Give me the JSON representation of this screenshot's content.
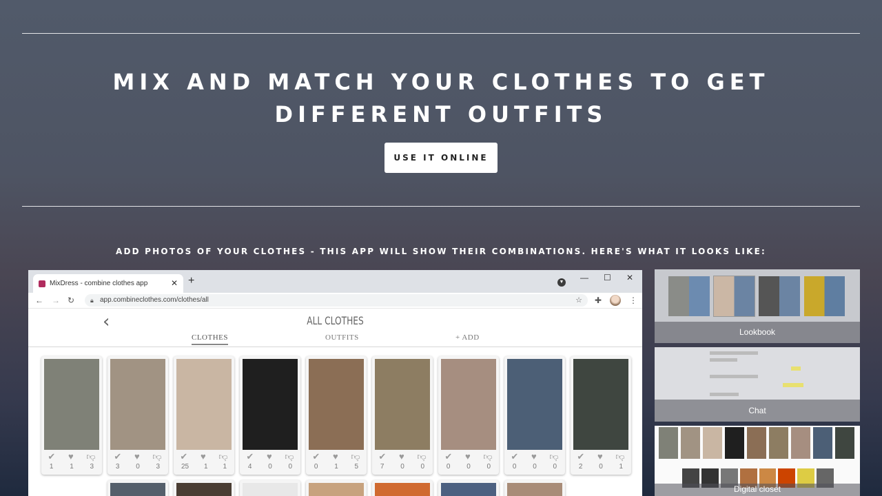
{
  "hero": {
    "title": "MIX AND MATCH YOUR CLOTHES TO GET DIFFERENT OUTFITS",
    "cta_label": "USE IT ONLINE"
  },
  "subtitle": "ADD PHOTOS OF YOUR CLOTHES - THIS APP WILL SHOW THEIR COMBINATIONS. HERE'S WHAT IT LOOKS LIKE:",
  "browser": {
    "tab_title": "MixDress - combine clothes app",
    "url": "app.combineclothes.com/clothes/all"
  },
  "app": {
    "title": "ALL CLOTHES",
    "tabs": [
      "CLOTHES",
      "OUTFITS",
      "+ ADD"
    ],
    "items": [
      {
        "likes": "1",
        "hearts": "1",
        "dislikes": "3",
        "color": "#7f8177"
      },
      {
        "likes": "3",
        "hearts": "0",
        "dislikes": "3",
        "color": "#a19383"
      },
      {
        "likes": "25",
        "hearts": "1",
        "dislikes": "1",
        "color": "#c9b6a3"
      },
      {
        "likes": "4",
        "hearts": "0",
        "dislikes": "0",
        "color": "#1f1f1f"
      },
      {
        "likes": "0",
        "hearts": "1",
        "dislikes": "5",
        "color": "#8b6e55"
      },
      {
        "likes": "7",
        "hearts": "0",
        "dislikes": "0",
        "color": "#8d7d62"
      },
      {
        "likes": "0",
        "hearts": "0",
        "dislikes": "0",
        "color": "#a68e80"
      },
      {
        "likes": "0",
        "hearts": "0",
        "dislikes": "0",
        "color": "#4c5f76"
      },
      {
        "likes": "2",
        "hearts": "0",
        "dislikes": "1",
        "color": "#3f4640"
      }
    ]
  },
  "thumbnails": [
    "Lookbook",
    "Chat",
    "Digital closet"
  ],
  "colors": {
    "accent_plum": "#b02c5e",
    "icon_gray": "#9a9a9a"
  }
}
